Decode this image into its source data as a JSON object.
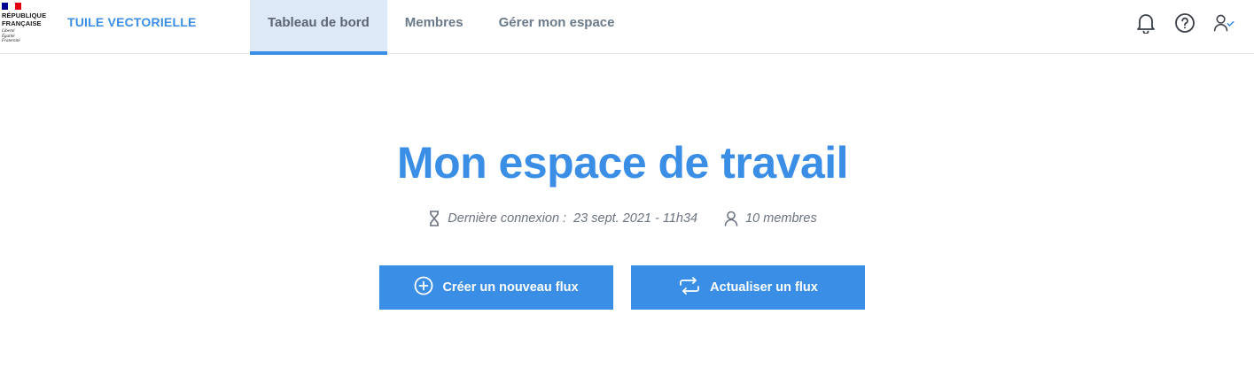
{
  "logo": {
    "name": "RÉPUBLIQUE\nFRANÇAISE",
    "motto": "Liberté\nÉgalité\nFraternité"
  },
  "service_name": "TUILE VECTORIELLE",
  "nav": {
    "tabs": [
      {
        "label": "Tableau de bord",
        "active": true
      },
      {
        "label": "Membres",
        "active": false
      },
      {
        "label": "Gérer mon espace",
        "active": false
      }
    ]
  },
  "header_icons": [
    "bell-icon",
    "help-icon",
    "user-check-icon"
  ],
  "main": {
    "title": "Mon espace de travail",
    "last_login_label": "Dernière connexion :",
    "last_login_value": "23 sept. 2021 - 11h34",
    "members": "10 membres"
  },
  "actions": {
    "create_label": "Créer un nouveau flux",
    "refresh_label": "Actualiser un flux"
  },
  "colors": {
    "accent": "#3a8ee6",
    "active_tab_bg": "#dde9f7",
    "muted_text": "#6b7280"
  }
}
